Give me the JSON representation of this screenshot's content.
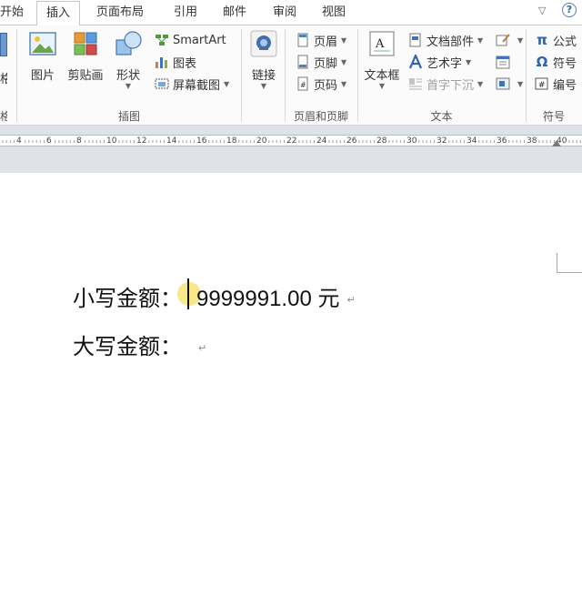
{
  "tabs": [
    {
      "id": "start",
      "label": "开始",
      "active": false
    },
    {
      "id": "insert",
      "label": "插入",
      "active": true
    },
    {
      "id": "layout",
      "label": "页面布局",
      "active": false
    },
    {
      "id": "references",
      "label": "引用",
      "active": false
    },
    {
      "id": "mailings",
      "label": "邮件",
      "active": false
    },
    {
      "id": "review",
      "label": "审阅",
      "active": false
    },
    {
      "id": "view",
      "label": "视图",
      "active": false
    }
  ],
  "tab_controls": {
    "collapse": "▽",
    "help": "?"
  },
  "ribbon": {
    "partial_left": {
      "label_char": "格",
      "group_char": "格"
    },
    "illustrations": {
      "group_label": "插图",
      "picture": "图片",
      "clipart": "剪贴画",
      "shapes": "形状",
      "smartart": "SmartArt",
      "chart": "图表",
      "screenshot": "屏幕截图"
    },
    "links": {
      "link": "链接"
    },
    "header_footer": {
      "group_label": "页眉和页脚",
      "header": "页眉",
      "footer": "页脚",
      "page_number": "页码"
    },
    "text": {
      "group_label": "文本",
      "textbox": "文本框",
      "quick_parts": "文档部件",
      "wordart": "艺术字",
      "dropcap": "首字下沉"
    },
    "symbols": {
      "group_label": "符号",
      "equation": "公式",
      "equation_glyph": "π",
      "symbol": "符号",
      "symbol_glyph": "Ω",
      "numbering": "编号"
    }
  },
  "ruler": {
    "numbers": [
      "4",
      "6",
      "8",
      "10",
      "12",
      "14",
      "16",
      "18",
      "20",
      "22",
      "24",
      "26",
      "28",
      "30",
      "32",
      "34",
      "36",
      "38",
      "40"
    ]
  },
  "document": {
    "line1": {
      "label": "小写金额：",
      "value": "9999991.00 元"
    },
    "line2": {
      "label": "大写金额："
    },
    "paragraph_mark": "↵"
  },
  "colors": {
    "ribbon_bg": "#fbfbfb",
    "ruler_bg": "#dfe3e8",
    "highlight": "#f6e064",
    "page": "#ffffff"
  }
}
